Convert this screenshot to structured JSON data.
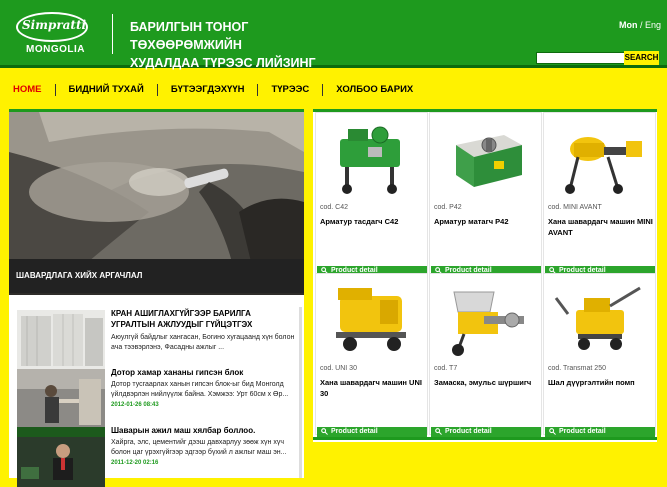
{
  "header": {
    "logo_brand": "Simpratti",
    "logo_sub": "MONGOLIA",
    "tagline_line1": "БАРИЛГЫН ТОНОГ ТӨХӨӨРӨМЖИЙН",
    "tagline_line2": "ХУДАЛДАА ТҮРЭЭС ЛИЙЗИНГ",
    "lang_mon": "Mon",
    "lang_sep": " / ",
    "lang_eng": "Eng",
    "search_label": "SEARCH",
    "search_value": ""
  },
  "nav": {
    "items": [
      "HOME",
      "БИДНИЙ ТУХАЙ",
      "БҮТЭЭГДЭХҮҮН",
      "ТҮРЭЭС",
      "ХОЛБОО БАРИХ"
    ]
  },
  "hero": {
    "caption": "ШАВАРДЛАГА ХИЙХ АРГАЧЛАЛ"
  },
  "news": [
    {
      "title": "КРАН АШИГЛАХГҮЙГЭЭР БАРИЛГА УГРАЛТЫН АЖЛУУДЫГ ГҮЙЦЭТГЭХ",
      "text": "Аюулгүй байдлыг хангасан, Богино хугацаанд хүн болон ача тээвэрлэнэ, Фасадны ажлыг ...",
      "date": ""
    },
    {
      "title": "Дотор хамар хананы гипсэн блок",
      "text": "Дотор тусгаарлах ханын гипсэн блок-ыг бид Монголд үйлдвэрлэн нийлүүлж байна. Хэмжээ: Урт 60см х Өр...",
      "date": "2012-01-26 08:43"
    },
    {
      "title": "Шаварын ажил маш хялбар боллоо.",
      "text": "Хайрга, элс, цементийг дээш давхарлуу зөөж хүн хүч болон цаг үрэхгүйгээр эдгээр бүхий л ажлыг маш эн...",
      "date": "2011-12-20 02:16"
    }
  ],
  "products": [
    {
      "code": "cod. C42",
      "name": "Арматур тасдагч C42",
      "button": "Product detail",
      "icon": "green-rebar-cutter"
    },
    {
      "code": "cod. P42",
      "name": "Арматур матагч P42",
      "button": "Product detail",
      "icon": "green-rebar-bender"
    },
    {
      "code": "cod. MINI AVANT",
      "name": "Хана шавардагч машин MINI AVANT",
      "button": "Product detail",
      "icon": "plaster-machine-small"
    },
    {
      "code": "cod. UNI 30",
      "name": "Хана шавардагч машин UNI 30",
      "button": "Product detail",
      "icon": "plaster-machine-yellow"
    },
    {
      "code": "cod. T7",
      "name": "Замаска, эмульс шүршигч",
      "button": "Product detail",
      "icon": "spray-pump"
    },
    {
      "code": "cod. Transmat 250",
      "name": "Шал дүүргэлтийн помп",
      "button": "Product detail",
      "icon": "floor-screed-pump"
    }
  ],
  "colors": {
    "header_green": "#1e9a1e",
    "page_yellow": "#fff200",
    "nav_active": "#e00000",
    "button_green": "#2ca52c"
  }
}
